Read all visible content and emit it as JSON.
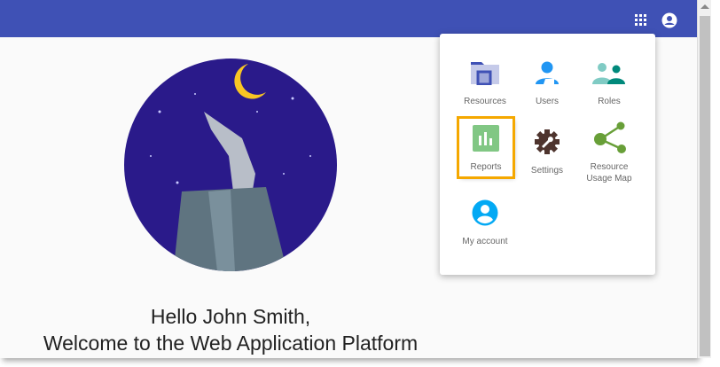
{
  "header": {
    "apps_icon": "grid-icon",
    "account_icon": "account-circle-icon"
  },
  "greeting": {
    "line1": "Hello John Smith,",
    "line2": "Welcome to the Web Application Platform"
  },
  "menu": {
    "items": [
      {
        "label": "Resources",
        "icon": "folder-icon",
        "color": "#3f51b5"
      },
      {
        "label": "Users",
        "icon": "user-icon",
        "color": "#2196f3"
      },
      {
        "label": "Roles",
        "icon": "roles-icon",
        "color": "#009688"
      },
      {
        "label": "Reports",
        "icon": "bar-chart-icon",
        "color": "#81c784",
        "selected": true
      },
      {
        "label": "Settings",
        "icon": "gear-wrench-icon",
        "color": "#4e342e"
      },
      {
        "label": "Resource Usage Map",
        "icon": "share-icon",
        "color": "#689f38"
      },
      {
        "label": "My account",
        "icon": "account-circle-icon",
        "color": "#03a9f4"
      }
    ]
  },
  "colors": {
    "header": "#3f51b5",
    "highlight": "#f5a800"
  }
}
